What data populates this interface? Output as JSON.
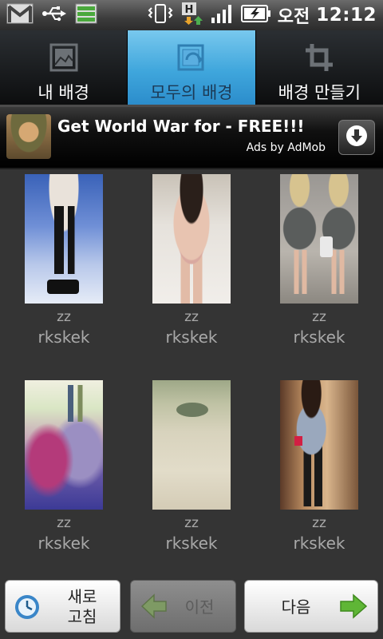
{
  "status_bar": {
    "ampm": "오전",
    "time": "12:12"
  },
  "tabs": [
    {
      "label": "내 배경",
      "active": false
    },
    {
      "label": "모두의 배경",
      "active": true
    },
    {
      "label": "배경 만들기",
      "active": false
    }
  ],
  "ad": {
    "title": "Get World War for - FREE!!!",
    "by": "Ads by AdMob"
  },
  "wallpapers": [
    {
      "name": "zz",
      "author": "rkskek"
    },
    {
      "name": "zz",
      "author": "rkskek"
    },
    {
      "name": "zz",
      "author": "rkskek"
    },
    {
      "name": "zz",
      "author": "rkskek"
    },
    {
      "name": "zz",
      "author": "rkskek"
    },
    {
      "name": "zz",
      "author": "rkskek"
    }
  ],
  "buttons": {
    "refresh_line1": "새로",
    "refresh_line2": "고침",
    "prev": "이전",
    "next": "다음"
  },
  "colors": {
    "active_tab": "#3fa6dc",
    "background": "#343434",
    "arrow_green": "#5fb636"
  }
}
